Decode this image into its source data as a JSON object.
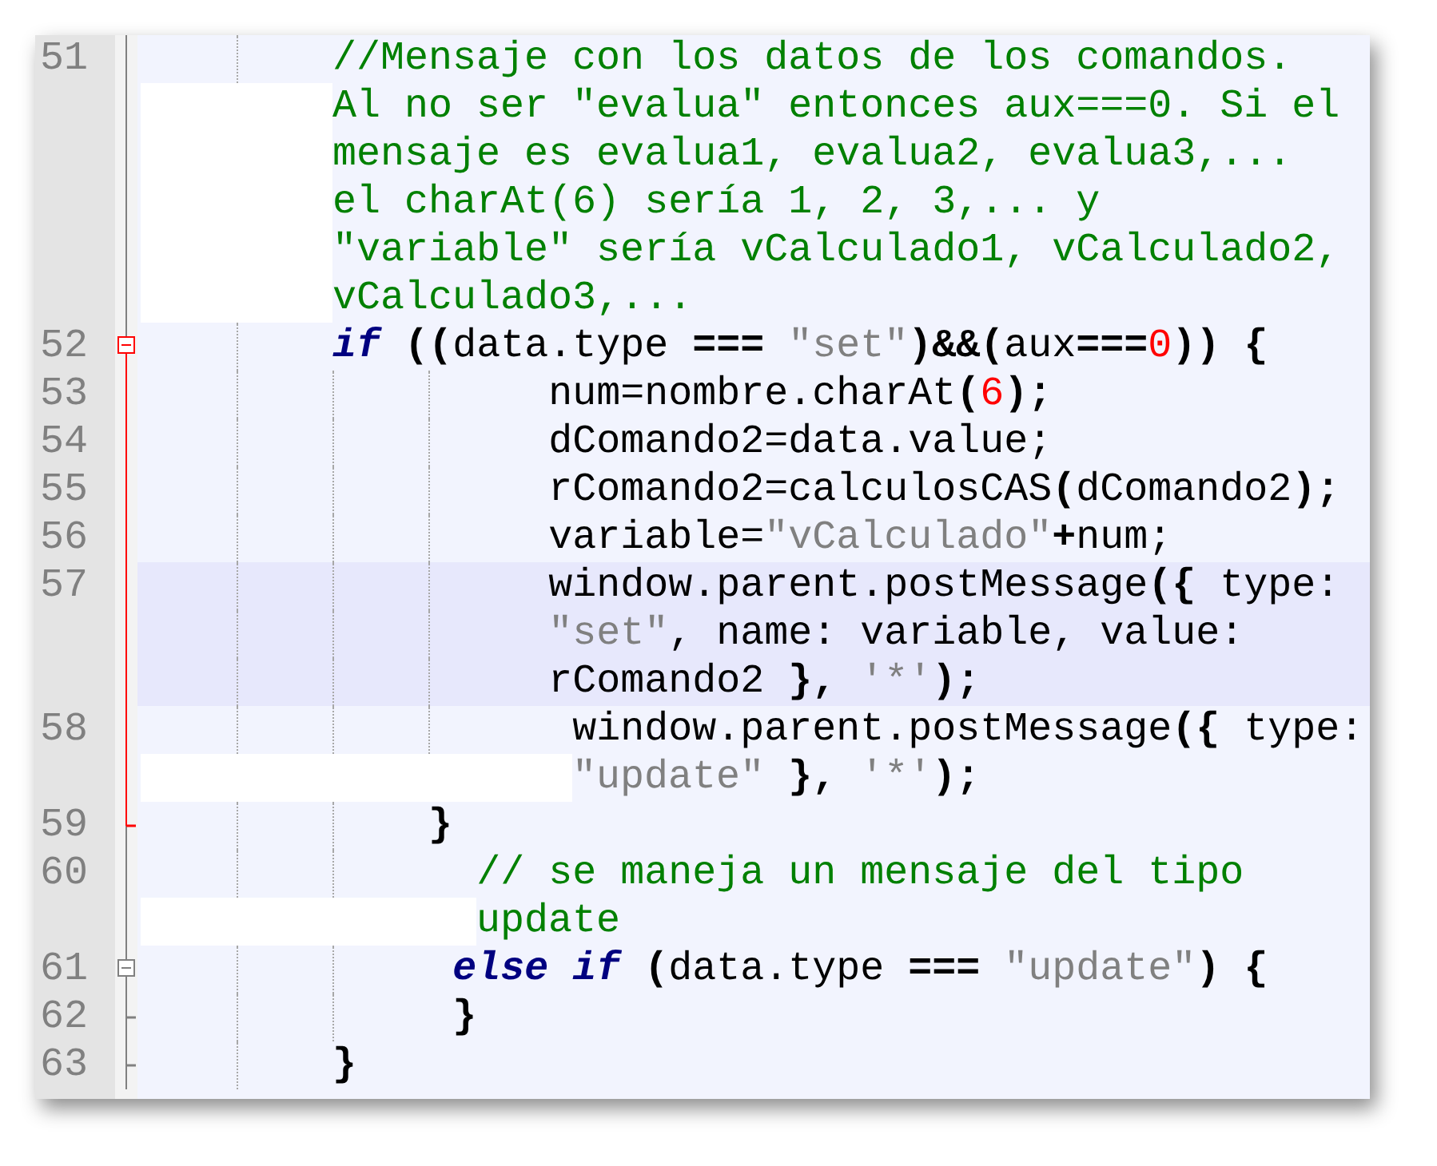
{
  "lines": [
    {
      "number": "51",
      "fold": {
        "kind": "line",
        "active": false
      },
      "highlighted": false,
      "rows": [
        {
          "indent": "        ",
          "tokens": [
            {
              "kind": "comment",
              "text": "//Mensaje con los datos de los comandos."
            }
          ]
        },
        {
          "indent": "        ",
          "tokens": [
            {
              "kind": "comment",
              "text": "Al no ser \"evalua\" entonces aux===0. Si el"
            }
          ]
        },
        {
          "indent": "        ",
          "tokens": [
            {
              "kind": "comment",
              "text": "mensaje es evalua1, evalua2, evalua3,..."
            }
          ]
        },
        {
          "indent": "        ",
          "tokens": [
            {
              "kind": "comment",
              "text": "el charAt(6) sería 1, 2, 3,... y"
            }
          ]
        },
        {
          "indent": "        ",
          "tokens": [
            {
              "kind": "comment",
              "text": "\"variable\" sería vCalculado1, vCalculado2,"
            }
          ]
        },
        {
          "indent": "        ",
          "tokens": [
            {
              "kind": "comment",
              "text": "vCalculado3,..."
            }
          ]
        }
      ]
    },
    {
      "number": "52",
      "fold": {
        "kind": "start",
        "active": true
      },
      "highlighted": false,
      "rows": [
        {
          "indent": "        ",
          "tokens": [
            {
              "kind": "keyword",
              "text": "if"
            },
            {
              "kind": "operator",
              "text": " (("
            },
            {
              "kind": "text",
              "text": "data.type "
            },
            {
              "kind": "operator",
              "text": "==="
            },
            {
              "kind": "string",
              "text": " \"set\""
            },
            {
              "kind": "operator",
              "text": ")&&("
            },
            {
              "kind": "text",
              "text": "aux"
            },
            {
              "kind": "operator",
              "text": "==="
            },
            {
              "kind": "number",
              "text": "0"
            },
            {
              "kind": "operator",
              "text": ")) {"
            }
          ]
        }
      ]
    },
    {
      "number": "53",
      "fold": {
        "kind": "line",
        "active": true
      },
      "highlighted": false,
      "rows": [
        {
          "indent": "                 ",
          "tokens": [
            {
              "kind": "text",
              "text": "num=nombre.charAt"
            },
            {
              "kind": "operator",
              "text": "("
            },
            {
              "kind": "number",
              "text": "6"
            },
            {
              "kind": "operator",
              "text": ");"
            }
          ]
        }
      ]
    },
    {
      "number": "54",
      "fold": {
        "kind": "line",
        "active": true
      },
      "highlighted": false,
      "rows": [
        {
          "indent": "                 ",
          "tokens": [
            {
              "kind": "text",
              "text": "dComando2=data.value;"
            }
          ]
        }
      ]
    },
    {
      "number": "55",
      "fold": {
        "kind": "line",
        "active": true
      },
      "highlighted": false,
      "rows": [
        {
          "indent": "                 ",
          "tokens": [
            {
              "kind": "text",
              "text": "rComando2=calculosCAS"
            },
            {
              "kind": "operator",
              "text": "("
            },
            {
              "kind": "text",
              "text": "dComando2"
            },
            {
              "kind": "operator",
              "text": ");"
            }
          ]
        }
      ]
    },
    {
      "number": "56",
      "fold": {
        "kind": "line",
        "active": true
      },
      "highlighted": false,
      "rows": [
        {
          "indent": "                 ",
          "tokens": [
            {
              "kind": "text",
              "text": "variable="
            },
            {
              "kind": "string",
              "text": "\"vCalculado\""
            },
            {
              "kind": "operator",
              "text": "+"
            },
            {
              "kind": "text",
              "text": "num;"
            }
          ]
        }
      ]
    },
    {
      "number": "57",
      "fold": {
        "kind": "line",
        "active": true
      },
      "highlighted": true,
      "rows": [
        {
          "indent": "                 ",
          "tokens": [
            {
              "kind": "text",
              "text": "window.parent.postMessage"
            },
            {
              "kind": "operator",
              "text": "({"
            },
            {
              "kind": "text",
              "text": " type:"
            }
          ]
        },
        {
          "indent": "                 ",
          "tokens": [
            {
              "kind": "string",
              "text": "\"set\""
            },
            {
              "kind": "text",
              "text": ", name: variable, value:"
            }
          ]
        },
        {
          "indent": "                 ",
          "tokens": [
            {
              "kind": "text",
              "text": "rComando2 "
            },
            {
              "kind": "operator",
              "text": "},"
            },
            {
              "kind": "string",
              "text": " '*'"
            },
            {
              "kind": "operator",
              "text": ");"
            }
          ]
        }
      ]
    },
    {
      "number": "58",
      "fold": {
        "kind": "line",
        "active": true
      },
      "highlighted": false,
      "rows": [
        {
          "indent": "                  ",
          "tokens": [
            {
              "kind": "text",
              "text": "window.parent.postMessage"
            },
            {
              "kind": "operator",
              "text": "({"
            },
            {
              "kind": "text",
              "text": " type:"
            }
          ]
        },
        {
          "indent": "                  ",
          "tokens": [
            {
              "kind": "string",
              "text": "\"update\""
            },
            {
              "kind": "operator",
              "text": " },"
            },
            {
              "kind": "string",
              "text": " '*'"
            },
            {
              "kind": "operator",
              "text": ");"
            }
          ]
        }
      ]
    },
    {
      "number": "59",
      "fold": {
        "kind": "end",
        "active": true
      },
      "highlighted": false,
      "rows": [
        {
          "indent": "            ",
          "tokens": [
            {
              "kind": "operator",
              "text": "}"
            }
          ]
        }
      ]
    },
    {
      "number": "60",
      "fold": {
        "kind": "line",
        "active": false
      },
      "highlighted": false,
      "rows": [
        {
          "indent": "              ",
          "tokens": [
            {
              "kind": "comment",
              "text": "// se maneja un mensaje del tipo"
            }
          ]
        },
        {
          "indent": "              ",
          "tokens": [
            {
              "kind": "comment",
              "text": "update"
            }
          ]
        }
      ]
    },
    {
      "number": "61",
      "fold": {
        "kind": "start",
        "active": false
      },
      "highlighted": false,
      "rows": [
        {
          "indent": "             ",
          "tokens": [
            {
              "kind": "keyword",
              "text": "else if"
            },
            {
              "kind": "operator",
              "text": " ("
            },
            {
              "kind": "text",
              "text": "data.type "
            },
            {
              "kind": "operator",
              "text": "==="
            },
            {
              "kind": "string",
              "text": " \"update\""
            },
            {
              "kind": "operator",
              "text": ") {"
            }
          ]
        }
      ]
    },
    {
      "number": "62",
      "fold": {
        "kind": "end",
        "active": false
      },
      "highlighted": false,
      "rows": [
        {
          "indent": "             ",
          "tokens": [
            {
              "kind": "operator",
              "text": "}"
            }
          ]
        }
      ]
    },
    {
      "number": "63",
      "fold": {
        "kind": "end",
        "active": false
      },
      "highlighted": false,
      "rows": [
        {
          "indent": "        ",
          "tokens": [
            {
              "kind": "operator",
              "text": "}"
            }
          ]
        }
      ]
    }
  ]
}
